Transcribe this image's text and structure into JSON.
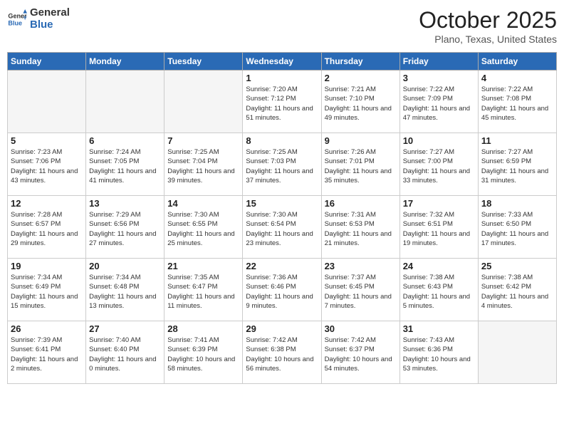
{
  "header": {
    "logo_general": "General",
    "logo_blue": "Blue",
    "month": "October 2025",
    "location": "Plano, Texas, United States"
  },
  "weekdays": [
    "Sunday",
    "Monday",
    "Tuesday",
    "Wednesday",
    "Thursday",
    "Friday",
    "Saturday"
  ],
  "weeks": [
    [
      {
        "day": "",
        "empty": true
      },
      {
        "day": "",
        "empty": true
      },
      {
        "day": "",
        "empty": true
      },
      {
        "day": "1",
        "sunrise": "7:20 AM",
        "sunset": "7:12 PM",
        "daylight": "11 hours and 51 minutes."
      },
      {
        "day": "2",
        "sunrise": "7:21 AM",
        "sunset": "7:10 PM",
        "daylight": "11 hours and 49 minutes."
      },
      {
        "day": "3",
        "sunrise": "7:22 AM",
        "sunset": "7:09 PM",
        "daylight": "11 hours and 47 minutes."
      },
      {
        "day": "4",
        "sunrise": "7:22 AM",
        "sunset": "7:08 PM",
        "daylight": "11 hours and 45 minutes."
      }
    ],
    [
      {
        "day": "5",
        "sunrise": "7:23 AM",
        "sunset": "7:06 PM",
        "daylight": "11 hours and 43 minutes."
      },
      {
        "day": "6",
        "sunrise": "7:24 AM",
        "sunset": "7:05 PM",
        "daylight": "11 hours and 41 minutes."
      },
      {
        "day": "7",
        "sunrise": "7:25 AM",
        "sunset": "7:04 PM",
        "daylight": "11 hours and 39 minutes."
      },
      {
        "day": "8",
        "sunrise": "7:25 AM",
        "sunset": "7:03 PM",
        "daylight": "11 hours and 37 minutes."
      },
      {
        "day": "9",
        "sunrise": "7:26 AM",
        "sunset": "7:01 PM",
        "daylight": "11 hours and 35 minutes."
      },
      {
        "day": "10",
        "sunrise": "7:27 AM",
        "sunset": "7:00 PM",
        "daylight": "11 hours and 33 minutes."
      },
      {
        "day": "11",
        "sunrise": "7:27 AM",
        "sunset": "6:59 PM",
        "daylight": "11 hours and 31 minutes."
      }
    ],
    [
      {
        "day": "12",
        "sunrise": "7:28 AM",
        "sunset": "6:57 PM",
        "daylight": "11 hours and 29 minutes."
      },
      {
        "day": "13",
        "sunrise": "7:29 AM",
        "sunset": "6:56 PM",
        "daylight": "11 hours and 27 minutes."
      },
      {
        "day": "14",
        "sunrise": "7:30 AM",
        "sunset": "6:55 PM",
        "daylight": "11 hours and 25 minutes."
      },
      {
        "day": "15",
        "sunrise": "7:30 AM",
        "sunset": "6:54 PM",
        "daylight": "11 hours and 23 minutes."
      },
      {
        "day": "16",
        "sunrise": "7:31 AM",
        "sunset": "6:53 PM",
        "daylight": "11 hours and 21 minutes."
      },
      {
        "day": "17",
        "sunrise": "7:32 AM",
        "sunset": "6:51 PM",
        "daylight": "11 hours and 19 minutes."
      },
      {
        "day": "18",
        "sunrise": "7:33 AM",
        "sunset": "6:50 PM",
        "daylight": "11 hours and 17 minutes."
      }
    ],
    [
      {
        "day": "19",
        "sunrise": "7:34 AM",
        "sunset": "6:49 PM",
        "daylight": "11 hours and 15 minutes."
      },
      {
        "day": "20",
        "sunrise": "7:34 AM",
        "sunset": "6:48 PM",
        "daylight": "11 hours and 13 minutes."
      },
      {
        "day": "21",
        "sunrise": "7:35 AM",
        "sunset": "6:47 PM",
        "daylight": "11 hours and 11 minutes."
      },
      {
        "day": "22",
        "sunrise": "7:36 AM",
        "sunset": "6:46 PM",
        "daylight": "11 hours and 9 minutes."
      },
      {
        "day": "23",
        "sunrise": "7:37 AM",
        "sunset": "6:45 PM",
        "daylight": "11 hours and 7 minutes."
      },
      {
        "day": "24",
        "sunrise": "7:38 AM",
        "sunset": "6:43 PM",
        "daylight": "11 hours and 5 minutes."
      },
      {
        "day": "25",
        "sunrise": "7:38 AM",
        "sunset": "6:42 PM",
        "daylight": "11 hours and 4 minutes."
      }
    ],
    [
      {
        "day": "26",
        "sunrise": "7:39 AM",
        "sunset": "6:41 PM",
        "daylight": "11 hours and 2 minutes."
      },
      {
        "day": "27",
        "sunrise": "7:40 AM",
        "sunset": "6:40 PM",
        "daylight": "11 hours and 0 minutes."
      },
      {
        "day": "28",
        "sunrise": "7:41 AM",
        "sunset": "6:39 PM",
        "daylight": "10 hours and 58 minutes."
      },
      {
        "day": "29",
        "sunrise": "7:42 AM",
        "sunset": "6:38 PM",
        "daylight": "10 hours and 56 minutes."
      },
      {
        "day": "30",
        "sunrise": "7:42 AM",
        "sunset": "6:37 PM",
        "daylight": "10 hours and 54 minutes."
      },
      {
        "day": "31",
        "sunrise": "7:43 AM",
        "sunset": "6:36 PM",
        "daylight": "10 hours and 53 minutes."
      },
      {
        "day": "",
        "empty": true
      }
    ]
  ]
}
